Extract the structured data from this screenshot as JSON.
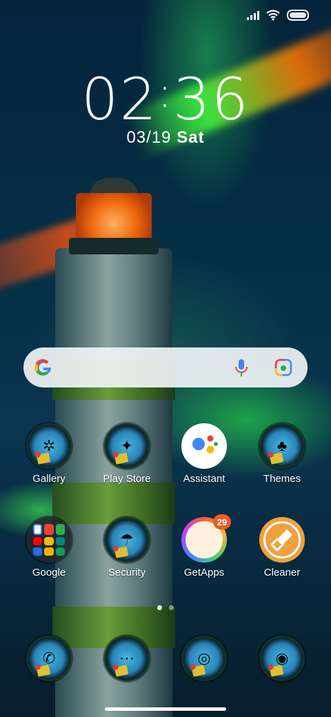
{
  "status_bar": {
    "signal": "signal-icon",
    "wifi": "wifi-icon",
    "battery": "battery-icon"
  },
  "lockscreen": {
    "time_hours": "02",
    "time_sep": ":",
    "time_minutes": "36",
    "date": "03/19",
    "weekday": "Sat"
  },
  "search": {
    "google_icon": "google-g-icon",
    "mic_icon": "mic-icon",
    "lens_icon": "google-lens-icon"
  },
  "apps_row1": [
    {
      "label": "Gallery",
      "icon": "gallery-icon"
    },
    {
      "label": "Play Store",
      "icon": "play-store-icon"
    },
    {
      "label": "Assistant",
      "icon": "assistant-icon"
    },
    {
      "label": "Themes",
      "icon": "themes-icon"
    }
  ],
  "apps_row2": [
    {
      "label": "Google",
      "icon": "google-folder-icon"
    },
    {
      "label": "Security",
      "icon": "security-icon"
    },
    {
      "label": "GetApps",
      "icon": "getapps-icon",
      "badge": "29"
    },
    {
      "label": "Cleaner",
      "icon": "cleaner-icon"
    }
  ],
  "dock": [
    {
      "icon": "phone-icon"
    },
    {
      "icon": "messages-icon"
    },
    {
      "icon": "browser-icon"
    },
    {
      "icon": "camera-icon"
    }
  ],
  "pager": {
    "pages": 2,
    "current": 1
  },
  "colors": {
    "notification_badge": "#f15a24",
    "cleaner": "#f0a040"
  }
}
